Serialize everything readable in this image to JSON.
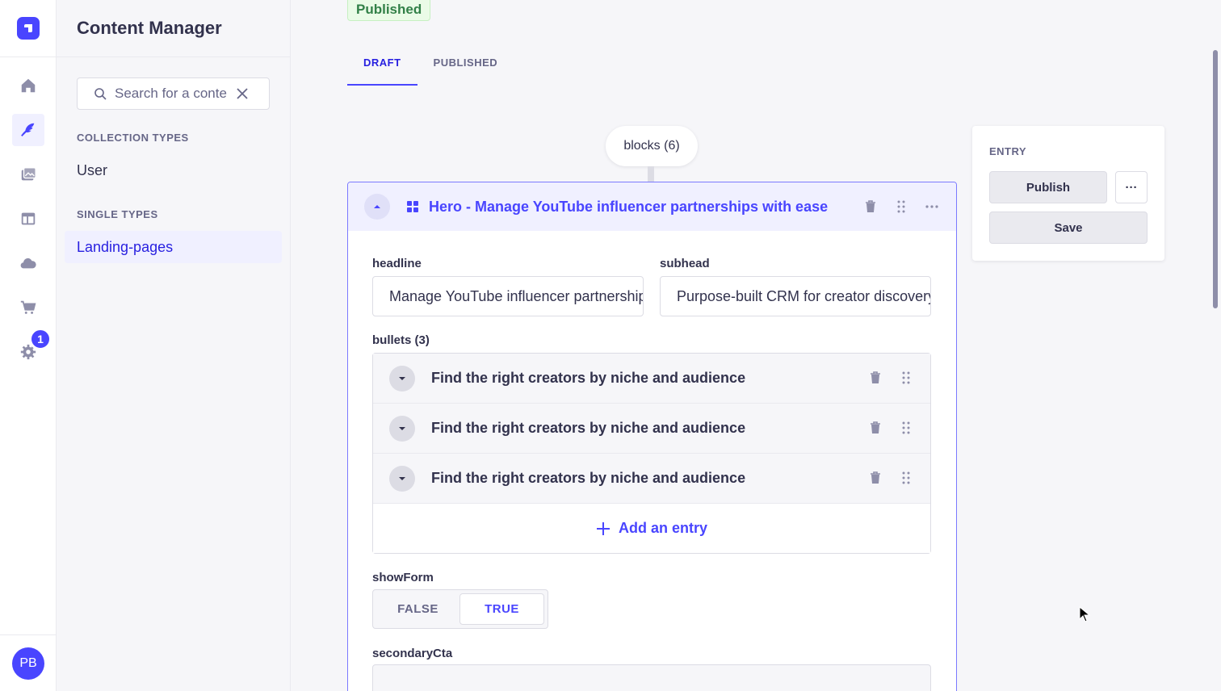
{
  "rail": {
    "items": [
      "home-icon",
      "content-manager-icon",
      "media-library-icon",
      "content-type-builder-icon",
      "cloud-icon",
      "marketplace-icon",
      "settings-icon"
    ],
    "settings_badge": "1",
    "avatar_initials": "PB"
  },
  "sidebar": {
    "title": "Content Manager",
    "search_placeholder": "Search for a content type",
    "collection_types_label": "COLLECTION TYPES",
    "collection_types": [
      "User"
    ],
    "single_types_label": "SINGLE TYPES",
    "single_types": [
      "Landing-pages"
    ]
  },
  "main": {
    "status_badge": "Published",
    "tabs": [
      {
        "label": "DRAFT",
        "active": true
      },
      {
        "label": "PUBLISHED",
        "active": false
      }
    ],
    "blocks_label": "blocks (6)",
    "block": {
      "title": "Hero - Manage YouTube influencer partnerships with ease",
      "headline_label": "headline",
      "headline_value": "Manage YouTube influencer partnerships with ease",
      "subhead_label": "subhead",
      "subhead_value": "Purpose-built CRM for creator discovery",
      "bullets_label": "bullets (3)",
      "bullets": [
        "Find the right creators by niche and audience",
        "Find the right creators by niche and audience",
        "Find the right creators by niche and audience"
      ],
      "add_entry_label": "Add an entry",
      "showform_label": "showForm",
      "showform_options": [
        "FALSE",
        "TRUE"
      ],
      "showform_value": "TRUE",
      "secondary_cta_label": "secondaryCta"
    }
  },
  "entry_panel": {
    "heading": "ENTRY",
    "publish_label": "Publish",
    "more_label": "···",
    "save_label": "Save"
  },
  "colors": {
    "accent": "#4945ff",
    "accent_light": "#f0f0ff",
    "success": "#328048"
  }
}
